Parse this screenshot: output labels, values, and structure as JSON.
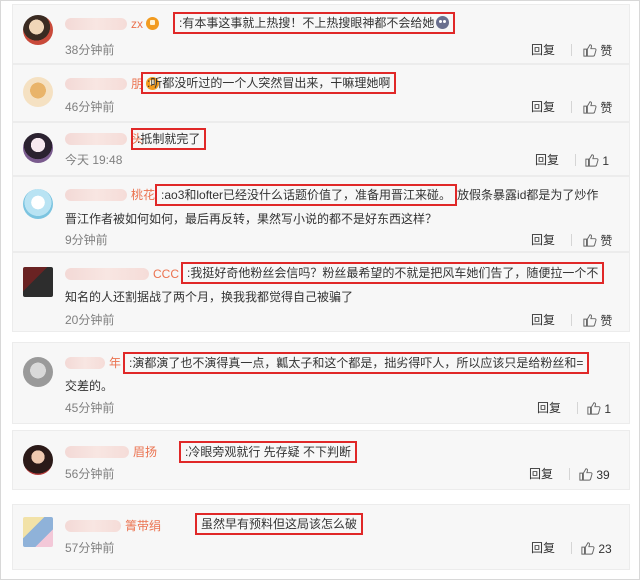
{
  "comments": [
    {
      "name_tail": "zx",
      "vip": true,
      "colon": ":",
      "text": "有本事这事就上热搜！不上热搜眼神都不会给她",
      "text_after": "",
      "time": "38分钟前",
      "reply": "回复",
      "like": "赞",
      "like_count": ""
    },
    {
      "name_tail": "朋",
      "vip": true,
      "colon": ":",
      "text": "听都没听过的一个人突然冒出来，干嘛理她啊",
      "text_after": "",
      "time": "46分钟前",
      "reply": "回复",
      "like": "赞",
      "like_count": ""
    },
    {
      "name_tail": "头",
      "vip": false,
      "colon": ":",
      "text": "抵制就完了",
      "text_after": "",
      "time": "今天 19:48",
      "reply": "回复",
      "like": "",
      "like_count": "1"
    },
    {
      "name_tail": "桃花",
      "vip": false,
      "colon": ":",
      "text": "ao3和lofter已经没什么话题价值了，准备用晋江来碰。",
      "text_after": "放假条暴露id都是为了炒作",
      "text_line2": "晋江作者被如何如何，最后再反转，果然写小说的都不是好东西这样？",
      "time": "9分钟前",
      "reply": "回复",
      "like": "赞",
      "like_count": ""
    },
    {
      "name_tail": "CCC",
      "vip": false,
      "colon": ":",
      "text": "我挺好奇他粉丝会信吗？粉丝最希望的不就是把风车她们告了，随便拉一个不",
      "text_after": "",
      "text_line2": "知名的人还割据战了两个月，换我我都觉得自己被骗了",
      "time": "20分钟前",
      "reply": "回复",
      "like": "赞",
      "like_count": ""
    },
    {
      "name_tail": "年",
      "vip": false,
      "colon": ":",
      "text": "演都演了也不演得真一点，瓤太子和这个都是，拙劣得吓人，所以应该只是给粉丝和=",
      "text_after": "",
      "text_line2": "交差的。",
      "time": "45分钟前",
      "reply": "回复",
      "like": "",
      "like_count": "1"
    },
    {
      "name_tail": "眉扬",
      "vip": false,
      "colon": ":",
      "text": "冷眼旁观就行 先存疑 不下判断",
      "text_after": "",
      "time": "56分钟前",
      "reply": "回复",
      "like": "",
      "like_count": "39"
    },
    {
      "name_tail": "箐带绢",
      "vip": false,
      "colon": "",
      "text": "虽然早有预料但这局该怎么破",
      "text_after": "",
      "time": "57分钟前",
      "reply": "回复",
      "like": "",
      "like_count": "23"
    }
  ],
  "colors": {
    "username": "#eb7350",
    "highlight_border": "#e02828",
    "time": "#808080",
    "card_bg": "#f7f7f7"
  },
  "icons": {
    "like": "thumbs-up-icon",
    "vip": "vip-badge-icon",
    "emoji": "emoji-icon"
  }
}
